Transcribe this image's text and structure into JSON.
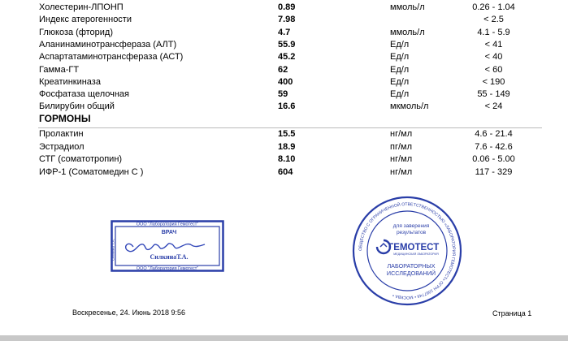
{
  "rows_top": [
    {
      "name": "Холестерин-ЛПОНП",
      "value": "0.89",
      "unit": "ммоль/л",
      "ref": "0.26 - 1.04"
    },
    {
      "name": "Индекс атерогенности",
      "value": "7.98",
      "unit": "",
      "ref": "< 2.5"
    },
    {
      "name": "Глюкоза (фторид)",
      "value": "4.7",
      "unit": "ммоль/л",
      "ref": "4.1 - 5.9"
    },
    {
      "name": "Аланинаминотрансфераза (АЛТ)",
      "value": "55.9",
      "unit": "Ед/л",
      "ref": "< 41"
    },
    {
      "name": "Аспартатаминотрансфераза (АСТ)",
      "value": "45.2",
      "unit": "Ед/л",
      "ref": "< 40"
    },
    {
      "name": "Гамма-ГТ",
      "value": "62",
      "unit": "Ед/л",
      "ref": "< 60"
    },
    {
      "name": "Креатинкиназа",
      "value": "400",
      "unit": "Ед/л",
      "ref": "< 190"
    },
    {
      "name": "Фосфатаза щелочная",
      "value": "59",
      "unit": "Ед/л",
      "ref": "55 - 149"
    },
    {
      "name": "Билирубин общий",
      "value": "16.6",
      "unit": "мкмоль/л",
      "ref": "< 24"
    }
  ],
  "section": {
    "title": "ГОРМОНЫ"
  },
  "rows_hormones": [
    {
      "name": "Пролактин",
      "value": "15.5",
      "unit": "нг/мл",
      "ref": "4.6 - 21.4"
    },
    {
      "name": "Эстрадиол",
      "value": "18.9",
      "unit": "пг/мл",
      "ref": "7.6 - 42.6"
    },
    {
      "name": "СТГ (соматотропин)",
      "value": "8.10",
      "unit": "нг/мл",
      "ref": "0.06 - 5.00"
    },
    {
      "name": "ИФР-1 (Соматомедин С )",
      "value": "604",
      "unit": "нг/мл",
      "ref": "117 - 329"
    }
  ],
  "doctor_stamp": {
    "top_text": "ООО \"Лаборатория Гемотест\"",
    "role": "ВРАЧ",
    "name": "СилкинаТ.А.",
    "bottom_text": "ООО \"Лаборатория Гемотест\"",
    "side_text": "Силкина Т.А."
  },
  "lab_stamp": {
    "line1": "для заверения",
    "line2": "результатов",
    "brand": "ГЕМОТЕСТ",
    "sub": "МЕДИЦИНСКАЯ ЛАБОРАТОРИЯ",
    "line3": "ЛАБОРАТОРНЫХ",
    "line4": "ИССЛЕДОВАНИЙ",
    "ring_text": "ОБЩЕСТВО С ОГРАНИЧЕННОЙ ОТВЕТСТВЕННОСТЬЮ «ЛАБОРАТОРИЯ ГЕМОТЕСТ» ОГРН 1067746 • МОСКВА •"
  },
  "footer": {
    "date": "Воскресенье, 24. Июнь 2018 9:56",
    "page": "Страница 1"
  },
  "colors": {
    "stamp_blue": "#2a3ea8",
    "signature_blue": "#3146b8"
  }
}
